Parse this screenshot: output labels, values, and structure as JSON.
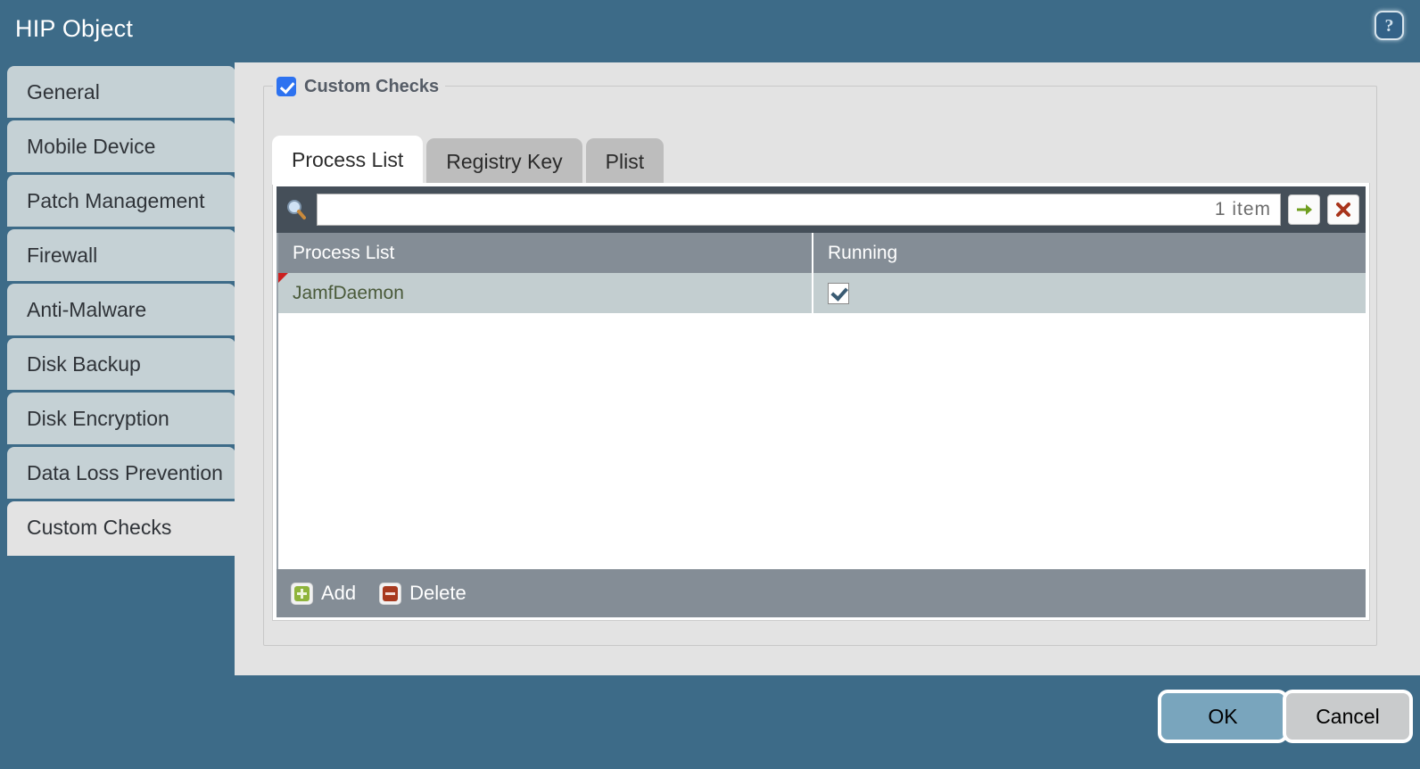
{
  "window": {
    "title": "HIP Object",
    "help_icon": "help-circle-icon",
    "help_label": "?"
  },
  "sidebar": {
    "items": [
      {
        "label": "General",
        "active": false
      },
      {
        "label": "Mobile Device",
        "active": false
      },
      {
        "label": "Patch Management",
        "active": false
      },
      {
        "label": "Firewall",
        "active": false
      },
      {
        "label": "Anti-Malware",
        "active": false
      },
      {
        "label": "Disk Backup",
        "active": false
      },
      {
        "label": "Disk Encryption",
        "active": false
      },
      {
        "label": "Data Loss Prevention",
        "active": false
      },
      {
        "label": "Custom Checks",
        "active": true
      }
    ]
  },
  "main": {
    "fieldset_legend": "Custom Checks",
    "fieldset_checked": true,
    "tabs": [
      {
        "label": "Process List",
        "active": true
      },
      {
        "label": "Registry Key",
        "active": false
      },
      {
        "label": "Plist",
        "active": false
      }
    ],
    "search": {
      "icon": "magnifier-icon",
      "value": "",
      "placeholder": "",
      "item_count": "1 item",
      "apply_icon": "arrow-right-icon",
      "clear_icon": "close-x-icon"
    },
    "table": {
      "columns": [
        "Process List",
        "Running"
      ],
      "rows": [
        {
          "process": "JamfDaemon",
          "running": true,
          "modified": true
        }
      ]
    },
    "table_footer": {
      "add_label": "Add",
      "add_icon": "plus-icon",
      "delete_label": "Delete",
      "delete_icon": "minus-icon"
    }
  },
  "footer": {
    "ok_label": "OK",
    "cancel_label": "Cancel"
  },
  "colors": {
    "header_blue": "#3d6b88",
    "sidebar_item": "#c5d1d5",
    "content_bg": "#e3e3e3",
    "toolbar_dark": "#454f59",
    "table_header": "#848d96",
    "row_selected": "#c3ced0",
    "checkbox_blue": "#2d72f0",
    "ok_button": "#79a5bd",
    "cancel_button": "#c9cbcc",
    "flag_red": "#cc1f1f"
  }
}
